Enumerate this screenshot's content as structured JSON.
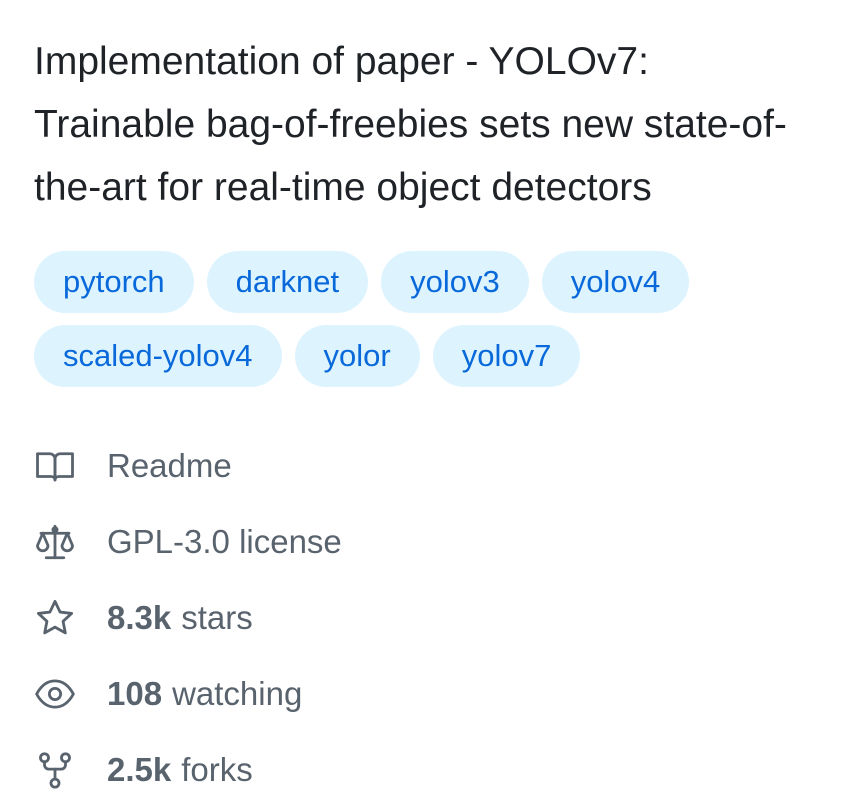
{
  "about": {
    "description": "Implementation of paper - YOLOv7: Trainable bag-of-freebies sets new state-of-the-art for real-time object detectors",
    "topics": [
      "pytorch",
      "darknet",
      "yolov3",
      "yolov4",
      "scaled-yolov4",
      "yolor",
      "yolov7"
    ]
  },
  "meta": {
    "readme": {
      "label": "Readme",
      "icon": "book-icon"
    },
    "license": {
      "label": "GPL-3.0 license",
      "icon": "law-scale-icon"
    },
    "stars": {
      "count": "8.3k",
      "label": "stars",
      "icon": "star-icon"
    },
    "watching": {
      "count": "108",
      "label": "watching",
      "icon": "eye-icon"
    },
    "forks": {
      "count": "2.5k",
      "label": "forks",
      "icon": "repo-forked-icon"
    }
  },
  "colors": {
    "topic_bg": "#ddf4ff",
    "topic_text": "#0969da",
    "muted_text": "#59636e",
    "primary_text": "#1f2328"
  }
}
